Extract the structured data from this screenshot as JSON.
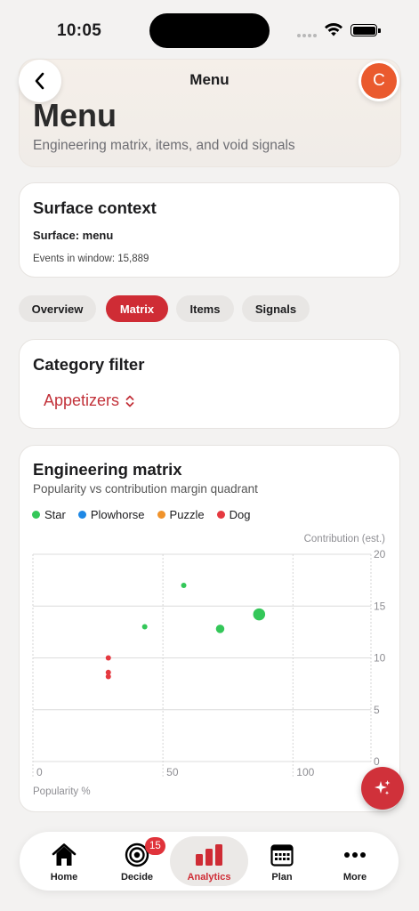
{
  "status_bar": {
    "time": "10:05"
  },
  "nav": {
    "title": "Menu",
    "avatar_initial": "C"
  },
  "hero": {
    "title": "Menu",
    "subtitle": "Engineering matrix, items, and void signals"
  },
  "context": {
    "title": "Surface context",
    "surface": "Surface: menu",
    "events": "Events in window: 15,889"
  },
  "tabs": [
    {
      "label": "Overview",
      "active": false
    },
    {
      "label": "Matrix",
      "active": true
    },
    {
      "label": "Items",
      "active": false
    },
    {
      "label": "Signals",
      "active": false
    }
  ],
  "filter": {
    "title": "Category filter",
    "selected": "Appetizers"
  },
  "matrix": {
    "title": "Engineering matrix",
    "subtitle": "Popularity vs contribution margin quadrant",
    "y_axis_label": "Contribution (est.)",
    "x_axis_label": "Popularity %"
  },
  "chart_data": {
    "type": "scatter",
    "title": "Engineering matrix",
    "subtitle": "Popularity vs contribution margin quadrant",
    "xlabel": "Popularity %",
    "ylabel": "Contribution (est.)",
    "xlim": [
      0,
      130
    ],
    "ylim": [
      0,
      20
    ],
    "x_ticks": [
      "0",
      "50",
      "100"
    ],
    "y_ticks": [
      "20",
      "15",
      "10",
      "5",
      "0"
    ],
    "grid": true,
    "legend_position": "top-left",
    "series": [
      {
        "name": "Star",
        "color": "#34c759",
        "points": [
          {
            "x": 58,
            "y": 17,
            "size": "small"
          },
          {
            "x": 43,
            "y": 13,
            "size": "small"
          },
          {
            "x": 72,
            "y": 12.8,
            "size": "medium"
          },
          {
            "x": 87,
            "y": 14.2,
            "size": "large"
          }
        ]
      },
      {
        "name": "Plowhorse",
        "color": "#1e88e5",
        "points": []
      },
      {
        "name": "Puzzle",
        "color": "#f0932b",
        "points": []
      },
      {
        "name": "Dog",
        "color": "#e53940",
        "points": [
          {
            "x": 29,
            "y": 10,
            "size": "small"
          },
          {
            "x": 29,
            "y": 8.6,
            "size": "small"
          },
          {
            "x": 29,
            "y": 8.2,
            "size": "small"
          }
        ]
      }
    ]
  },
  "tab_bar": {
    "items": [
      {
        "label": "Home",
        "icon": "house-icon"
      },
      {
        "label": "Decide",
        "icon": "target-icon",
        "badge": "15"
      },
      {
        "label": "Analytics",
        "icon": "bar-chart-icon",
        "active": true
      },
      {
        "label": "Plan",
        "icon": "calendar-icon"
      },
      {
        "label": "More",
        "icon": "ellipsis-icon"
      }
    ]
  },
  "colors": {
    "accent": "#cf2c35",
    "avatar": "#ea5a2e"
  }
}
